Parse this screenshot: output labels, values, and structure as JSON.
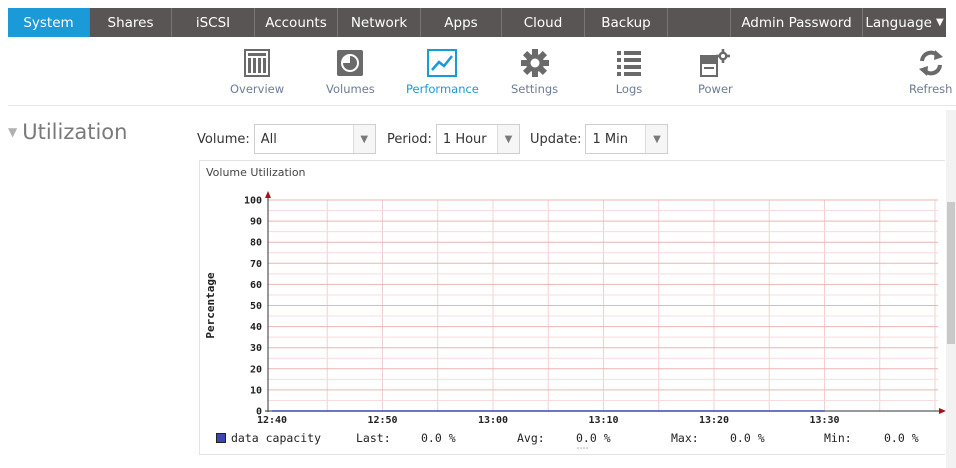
{
  "topnav": {
    "tabs": [
      {
        "label": "System",
        "active": true
      },
      {
        "label": "Shares"
      },
      {
        "label": "iSCSI"
      },
      {
        "label": "Accounts"
      },
      {
        "label": "Network"
      },
      {
        "label": "Apps"
      },
      {
        "label": "Cloud"
      },
      {
        "label": "Backup"
      },
      {
        "label": ""
      },
      {
        "label": "Admin Password"
      },
      {
        "label": "Language"
      }
    ],
    "active_color": "#1a9ad6",
    "tab_color": "#5a5555"
  },
  "subnav": {
    "items": [
      {
        "label": "Overview",
        "icon": "overview-icon"
      },
      {
        "label": "Volumes",
        "icon": "volumes-icon"
      },
      {
        "label": "Performance",
        "icon": "performance-icon",
        "active": true
      },
      {
        "label": "Settings",
        "icon": "gear-icon"
      },
      {
        "label": "Logs",
        "icon": "logs-icon"
      },
      {
        "label": "Power",
        "icon": "power-icon"
      },
      {
        "label": "Refresh",
        "icon": "refresh-icon"
      }
    ]
  },
  "section": {
    "title": "Utilization"
  },
  "filters": {
    "volume": {
      "label": "Volume:",
      "value": "All"
    },
    "period": {
      "label": "Period:",
      "value": "1 Hour"
    },
    "update": {
      "label": "Update:",
      "value": "1 Min"
    }
  },
  "chart_data": {
    "type": "line",
    "title": "Volume Utilization",
    "ylabel": "Percentage",
    "xlabel": "",
    "ylim": [
      0,
      100
    ],
    "y_ticks": [
      "0",
      "10",
      "20",
      "30",
      "40",
      "50",
      "60",
      "70",
      "80",
      "90",
      "100"
    ],
    "x_ticks": [
      "12:40",
      "12:50",
      "13:00",
      "13:10",
      "13:20",
      "13:30"
    ],
    "grid": true,
    "series": [
      {
        "name": "data capacity",
        "color": "#3b46b0",
        "x": [
          "12:40",
          "12:50",
          "13:00",
          "13:10",
          "13:20",
          "13:30"
        ],
        "values": [
          0,
          0,
          0,
          0,
          0,
          0
        ]
      }
    ],
    "legend": {
      "series_name": "data capacity",
      "last_label": "Last:",
      "last_value": "0.0 %",
      "avg_label": "Avg:",
      "avg_value": "0.0 %",
      "max_label": "Max:",
      "max_value": "0.0 %",
      "min_label": "Min:",
      "min_value": "0.0 %"
    }
  }
}
